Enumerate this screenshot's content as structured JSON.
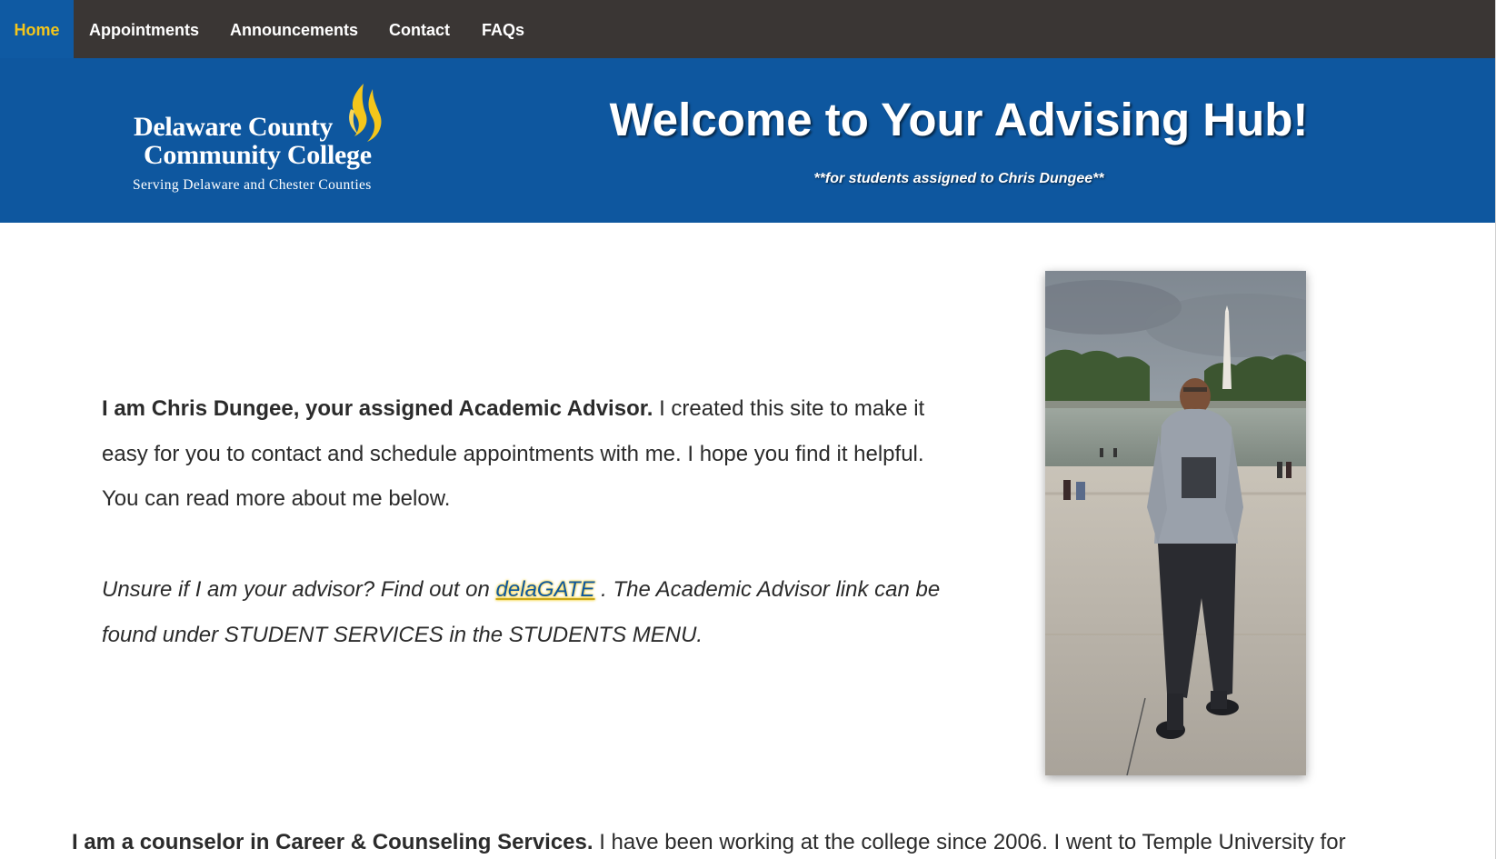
{
  "nav": {
    "items": [
      {
        "label": "Home",
        "active": true
      },
      {
        "label": "Appointments",
        "active": false
      },
      {
        "label": "Announcements",
        "active": false
      },
      {
        "label": "Contact",
        "active": false
      },
      {
        "label": "FAQs",
        "active": false
      }
    ]
  },
  "banner": {
    "logo": {
      "line1": "Delaware County",
      "line2": "Community College",
      "line3": "Serving Delaware and Chester Counties"
    },
    "title": "Welcome to Your Advising Hub!",
    "subtitle": "**for students assigned to Chris Dungee**"
  },
  "intro": {
    "bold": "I am Chris Dungee, your assigned Academic Advisor.",
    "text": " I created this site to make it easy for you to contact and schedule appointments with me. I hope you find it helpful. You can read more about me below."
  },
  "unsure": {
    "before": "Unsure if I am your advisor? Find out on ",
    "link": "delaGATE",
    "after": " . The Academic Advisor link can be found under STUDENT SERVICES in the STUDENTS MENU."
  },
  "counselor": {
    "bold": "I am a counselor in Career & Counseling Services.",
    "text": " I have been working at the college since 2006. I went to Temple University for"
  },
  "colors": {
    "nav_bg": "#3a3634",
    "banner_bg": "#0e579f",
    "accent_gold": "#f4c61b",
    "text": "#2b2b2b"
  }
}
